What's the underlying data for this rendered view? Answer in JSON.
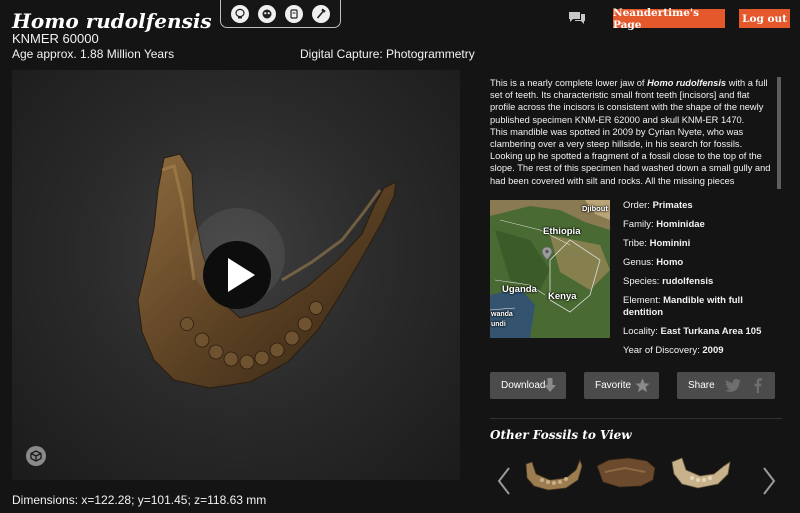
{
  "header": {
    "title": "Homo rudolfensis",
    "specimen": "KNMER 60000",
    "age": "Age approx. 1.88 Million Years",
    "capture": "Digital Capture: Photogrammetry",
    "nav_button": "Neandertime's Page",
    "logout_button": "Log out"
  },
  "toolbar": {
    "tools": [
      "skull-view-icon",
      "jaw-view-icon",
      "specimen-view-icon",
      "measure-icon"
    ]
  },
  "viewer": {
    "dimensions": "Dimensions:  x=122.28; y=101.45; z=118.63 mm"
  },
  "description": {
    "p1_pre": " This is a nearly complete lower jaw of ",
    "p1_em": "Homo rudolfensis",
    "p1_post": " with a full set of teeth. Its characteristic small front teeth [incisors] and flat profile across the incisors is consistent with the shape of the newly published specimen KNM-ER 62000 and skull KNM-ER 1470.",
    "p2": "This mandible was spotted in 2009 by Cyrian Nyete, who was clambering over  a very steep hillside, in his search for fossils. Looking up he spotted a fragment of a fossil close to the top of the slope. The rest of this specimen had washed down a small gully and had been covered with silt and rocks. All the missing pieces"
  },
  "map": {
    "labels": {
      "djibouti": "Djibout",
      "ethiopia": "Ethiopia",
      "uganda": "Uganda",
      "kenya": "Kenya",
      "rwanda": "wanda",
      "burundi": "undi"
    }
  },
  "taxonomy": {
    "order_label": "Order: ",
    "order": "Primates",
    "family_label": "Family: ",
    "family": "Hominidae",
    "tribe_label": "Tribe: ",
    "tribe": "Hominini",
    "genus_label": "Genus: ",
    "genus": "Homo",
    "species_label": "Species: ",
    "species": "rudolfensis",
    "element_label": "Element: ",
    "element": "Mandible with full dentition",
    "locality_label": "Locality: ",
    "locality": "East Turkana Area 105",
    "year_label": "Year of Discovery: ",
    "year": "2009"
  },
  "actions": {
    "download": "Download",
    "favorite": "Favorite",
    "share": "Share"
  },
  "other": {
    "title": "Other Fossils to View"
  },
  "colors": {
    "accent": "#e4582b",
    "background": "#141414",
    "button": "#4b4b4b"
  }
}
